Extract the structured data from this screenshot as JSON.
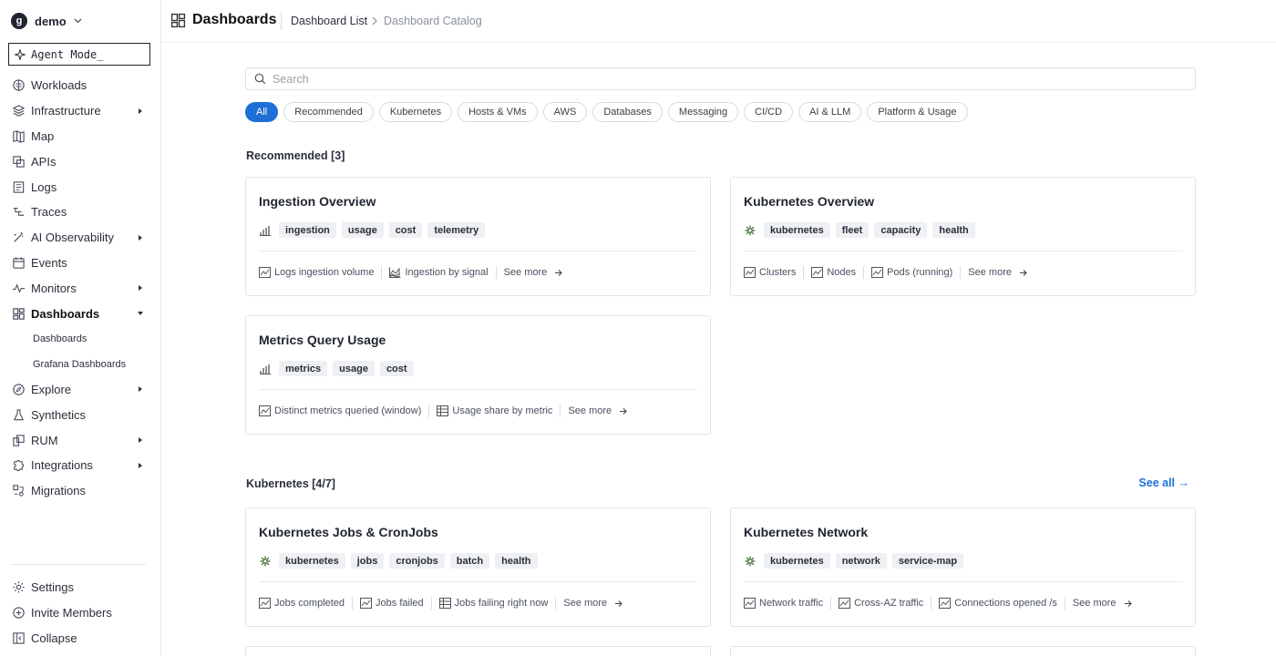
{
  "sidebar": {
    "org": {
      "initial": "g",
      "name": "demo"
    },
    "agent_mode": "Agent Mode_",
    "items": [
      {
        "label": "Workloads",
        "icon": "workloads-icon",
        "expandable": false
      },
      {
        "label": "Infrastructure",
        "icon": "layers-icon",
        "expandable": true
      },
      {
        "label": "Map",
        "icon": "map-icon",
        "expandable": false
      },
      {
        "label": "APIs",
        "icon": "api-icon",
        "expandable": false
      },
      {
        "label": "Logs",
        "icon": "logs-icon",
        "expandable": false
      },
      {
        "label": "Traces",
        "icon": "traces-icon",
        "expandable": false
      },
      {
        "label": "AI Observability",
        "icon": "ai-icon",
        "expandable": true
      },
      {
        "label": "Events",
        "icon": "calendar-icon",
        "expandable": false
      },
      {
        "label": "Monitors",
        "icon": "pulse-icon",
        "expandable": true
      },
      {
        "label": "Dashboards",
        "icon": "dashboard-icon",
        "expandable": true,
        "active": true
      }
    ],
    "sub_items": [
      "Dashboards",
      "Grafana Dashboards"
    ],
    "items_after": [
      {
        "label": "Explore",
        "icon": "compass-icon",
        "expandable": true
      },
      {
        "label": "Synthetics",
        "icon": "flask-icon",
        "expandable": false
      },
      {
        "label": "RUM",
        "icon": "rum-icon",
        "expandable": true
      },
      {
        "label": "Integrations",
        "icon": "puzzle-icon",
        "expandable": true
      },
      {
        "label": "Migrations",
        "icon": "migrate-icon",
        "expandable": false
      }
    ],
    "bottom": [
      {
        "label": "Settings",
        "icon": "gear-icon"
      },
      {
        "label": "Invite Members",
        "icon": "plus-circle-icon"
      },
      {
        "label": "Collapse",
        "icon": "collapse-icon"
      }
    ]
  },
  "header": {
    "title": "Dashboards",
    "breadcrumb": [
      "Dashboard List",
      "Dashboard Catalog"
    ]
  },
  "search": {
    "placeholder": "Search",
    "value": ""
  },
  "filters": [
    "All",
    "Recommended",
    "Kubernetes",
    "Hosts & VMs",
    "AWS",
    "Databases",
    "Messaging",
    "CI/CD",
    "AI & LLM",
    "Platform & Usage"
  ],
  "active_filter": "All",
  "sections": {
    "recommended": {
      "title": "Recommended [3]"
    },
    "kubernetes": {
      "title": "Kubernetes [4/7]",
      "see_all": "See all →"
    }
  },
  "see_more_label": "See more",
  "cards": {
    "ingestion": {
      "title": "Ingestion Overview",
      "icon": "bar-chart-icon",
      "tags": [
        "ingestion",
        "usage",
        "cost",
        "telemetry"
      ],
      "links": [
        {
          "label": "Logs ingestion volume",
          "icon": "line-chart-icon"
        },
        {
          "label": "Ingestion by signal",
          "icon": "area-chart-icon"
        }
      ]
    },
    "k8s_overview": {
      "title": "Kubernetes Overview",
      "icon": "kubernetes-icon",
      "tags": [
        "kubernetes",
        "fleet",
        "capacity",
        "health"
      ],
      "links": [
        {
          "label": "Clusters",
          "icon": "line-chart-icon"
        },
        {
          "label": "Nodes",
          "icon": "line-chart-icon"
        },
        {
          "label": "Pods (running)",
          "icon": "line-chart-icon"
        }
      ]
    },
    "metrics_query": {
      "title": "Metrics Query Usage",
      "icon": "bar-chart-icon",
      "tags": [
        "metrics",
        "usage",
        "cost"
      ],
      "links": [
        {
          "label": "Distinct metrics queried (window)",
          "icon": "line-chart-icon"
        },
        {
          "label": "Usage share by metric",
          "icon": "table-icon"
        }
      ]
    },
    "k8s_jobs": {
      "title": "Kubernetes Jobs & CronJobs",
      "icon": "kubernetes-icon",
      "tags": [
        "kubernetes",
        "jobs",
        "cronjobs",
        "batch",
        "health"
      ],
      "links": [
        {
          "label": "Jobs completed",
          "icon": "line-chart-icon"
        },
        {
          "label": "Jobs failed",
          "icon": "line-chart-icon"
        },
        {
          "label": "Jobs failing right now",
          "icon": "table-icon"
        }
      ]
    },
    "k8s_network": {
      "title": "Kubernetes Network",
      "icon": "kubernetes-icon",
      "tags": [
        "kubernetes",
        "network",
        "service-map"
      ],
      "links": [
        {
          "label": "Network traffic",
          "icon": "line-chart-icon"
        },
        {
          "label": "Cross-AZ traffic",
          "icon": "line-chart-icon"
        },
        {
          "label": "Connections opened /s",
          "icon": "line-chart-icon"
        }
      ]
    }
  }
}
